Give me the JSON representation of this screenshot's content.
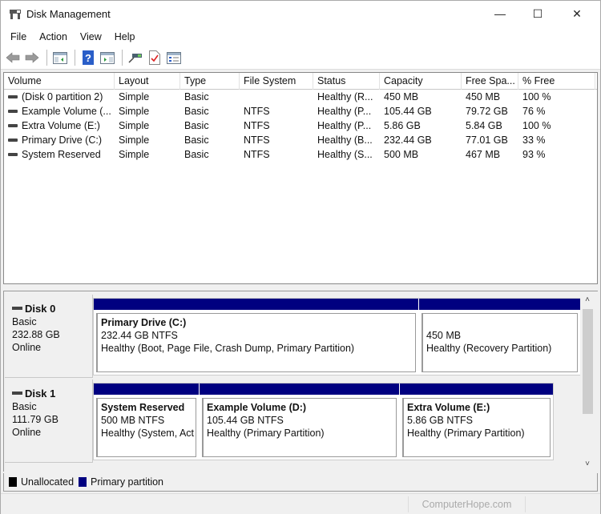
{
  "window": {
    "title": "Disk Management",
    "controls": {
      "minimize": "—",
      "maximize": "☐",
      "close": "✕"
    }
  },
  "menu": [
    "File",
    "Action",
    "View",
    "Help"
  ],
  "toolbar": {
    "buttons": [
      {
        "icon": "back-arrow-icon"
      },
      {
        "icon": "forward-arrow-icon"
      },
      {
        "icon": "show-hide-console-tree-icon"
      },
      {
        "icon": "help-icon"
      },
      {
        "icon": "show-hide-action-pane-icon"
      },
      {
        "icon": "connect-drive-icon"
      },
      {
        "icon": "check-properties-icon"
      },
      {
        "icon": "settings-list-icon"
      }
    ]
  },
  "volume_list": {
    "columns": [
      "Volume",
      "Layout",
      "Type",
      "File System",
      "Status",
      "Capacity",
      "Free Spa...",
      "% Free"
    ],
    "rows": [
      [
        "(Disk 0 partition 2)",
        "Simple",
        "Basic",
        "",
        "Healthy (R...",
        "450 MB",
        "450 MB",
        "100 %"
      ],
      [
        "Example Volume (...",
        "Simple",
        "Basic",
        "NTFS",
        "Healthy (P...",
        "105.44 GB",
        "79.72 GB",
        "76 %"
      ],
      [
        "Extra Volume (E:)",
        "Simple",
        "Basic",
        "NTFS",
        "Healthy (P...",
        "5.86 GB",
        "5.84 GB",
        "100 %"
      ],
      [
        "Primary Drive (C:)",
        "Simple",
        "Basic",
        "NTFS",
        "Healthy (B...",
        "232.44 GB",
        "77.01 GB",
        "33 %"
      ],
      [
        "System Reserved",
        "Simple",
        "Basic",
        "NTFS",
        "Healthy (S...",
        "500 MB",
        "467 MB",
        "93 %"
      ]
    ]
  },
  "disks": [
    {
      "name": "Disk 0",
      "type": "Basic",
      "size": "232.88 GB",
      "status": "Online",
      "partitions": [
        {
          "title": "Primary Drive  (C:)",
          "size": "232.44 GB NTFS",
          "status": "Healthy (Boot, Page File, Crash Dump, Primary Partition)"
        },
        {
          "title": "",
          "size": "450 MB",
          "status": "Healthy (Recovery Partition)"
        }
      ]
    },
    {
      "name": "Disk 1",
      "type": "Basic",
      "size": "111.79 GB",
      "status": "Online",
      "partitions": [
        {
          "title": "System Reserved",
          "size": "500 MB NTFS",
          "status": "Healthy (System, Act"
        },
        {
          "title": "Example Volume  (D:)",
          "size": "105.44 GB NTFS",
          "status": "Healthy (Primary Partition)"
        },
        {
          "title": "Extra Volume  (E:)",
          "size": "5.86 GB NTFS",
          "status": "Healthy (Primary Partition)"
        }
      ]
    }
  ],
  "legend": [
    {
      "label": "Unallocated",
      "color": "#000000"
    },
    {
      "label": "Primary partition",
      "color": "#000080"
    }
  ],
  "colors": {
    "primary_partition": "#000080",
    "unallocated": "#000000"
  },
  "statusbar": {
    "watermark": "ComputerHope.com"
  }
}
